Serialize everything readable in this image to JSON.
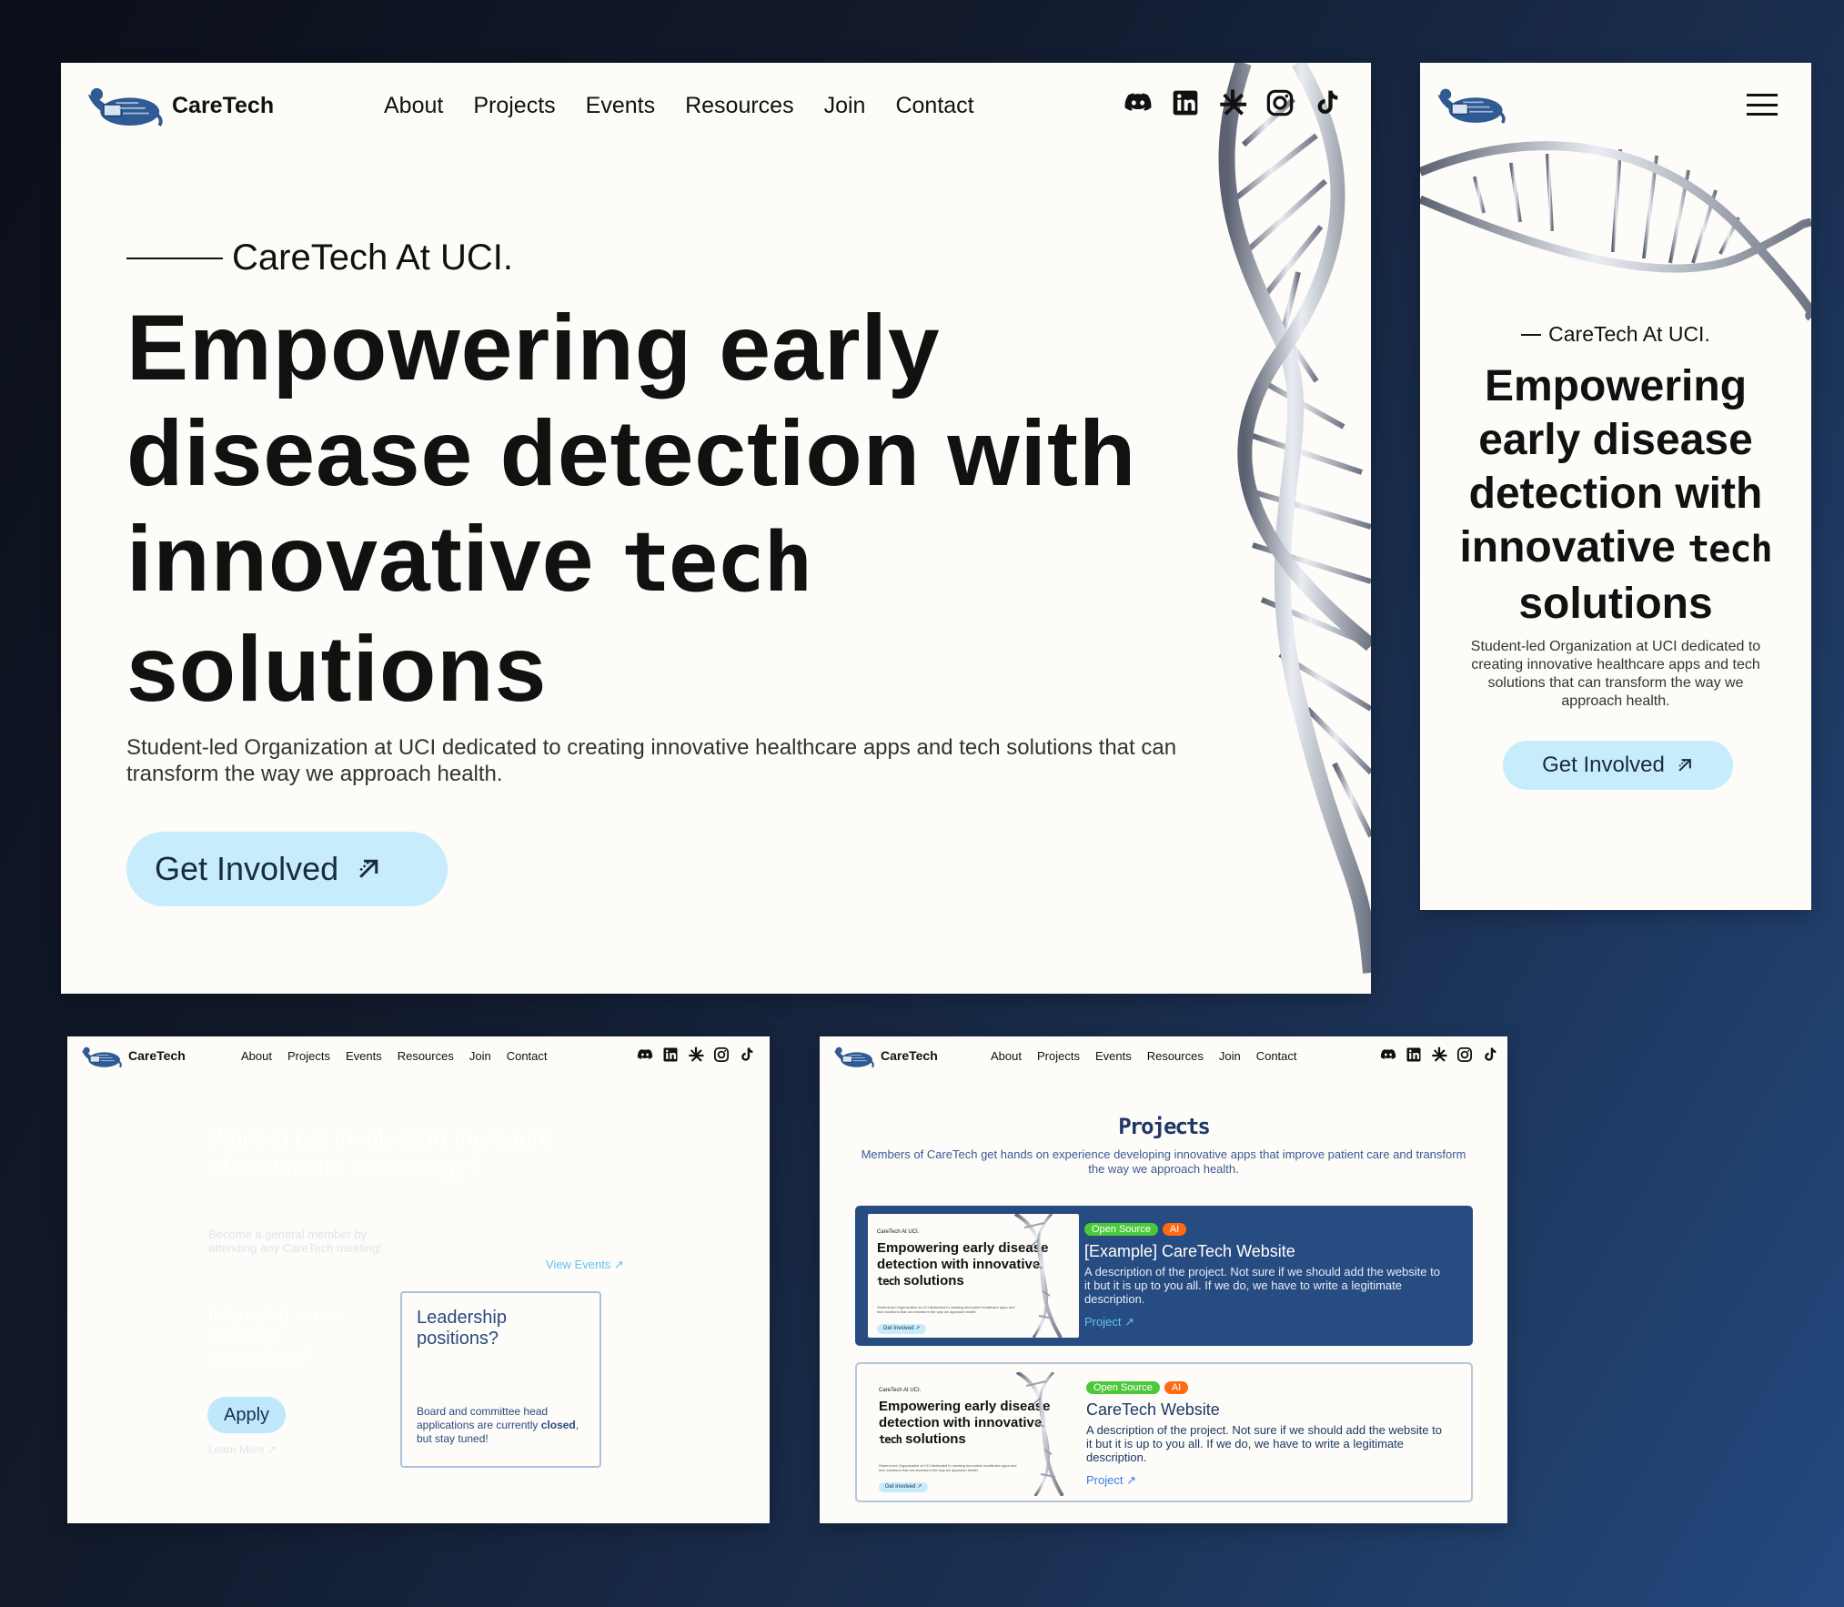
{
  "brand": "CareTech",
  "nav": [
    "About",
    "Projects",
    "Events",
    "Resources",
    "Join",
    "Contact"
  ],
  "social_icons": [
    "discord-icon",
    "linkedin-icon",
    "linktree-icon",
    "instagram-icon",
    "tiktok-icon"
  ],
  "hero": {
    "kicker": "CareTech At UCI.",
    "headline_main": "Empowering early disease detection with innovative",
    "headline_tech": "tech",
    "headline_end": "solutions",
    "mobile_line1": "Empowering",
    "mobile_line2": "early disease",
    "mobile_line3": "detection with",
    "mobile_line4a": "innovative",
    "subtitle": "Student-led Organization at UCI dedicated to creating innovative healthcare apps and tech solutions that can transform the way we approach health.",
    "cta": "Get Involved",
    "cta_icon": "arrow-up-right-icon"
  },
  "involve": {
    "card1_title": "Want to get involved in the future of healthcare technology?",
    "card1_sub": "Become a general member by attending any CareTech meeting!",
    "card1_link": "View Events ↗",
    "card2_title": "Interested in our amazing committees?",
    "card2_button": "Apply",
    "card2_link": "Learn More ↗",
    "card3_title": "Leadership positions?",
    "card3_text_a": "Board and committee head applications are currently ",
    "card3_text_b": "closed",
    "card3_text_c": ", but stay tuned!"
  },
  "projects": {
    "title": "Projects",
    "description": "Members of CareTech get hands on experience developing innovative apps that improve patient care and transform the way we approach health.",
    "thumb_kicker": "CareTech At UCI.",
    "thumb_head": "Empowering early disease detection with innovative",
    "thumb_tech": "tech",
    "thumb_end": "solutions",
    "thumb_sub": "Student-led Organization at UCI dedicated to creating innovative healthcare apps and tech solutions that can transform the way we approach health.",
    "thumb_cta": "Get Involved ↗",
    "items": [
      {
        "tags": [
          "Open Source",
          "AI"
        ],
        "name": "[Example] CareTech Website",
        "description": "A description of the project. Not sure if we should add the website to it but it is up to you all. If we do, we have to write a legitimate description.",
        "link": "Project ↗"
      },
      {
        "tags": [
          "Open Source",
          "AI"
        ],
        "name": "CareTech Website",
        "description": "A description of the project. Not sure if we should add the website to it but it is up to you all. If we do, we have to write a legitimate description.",
        "link": "Project ↗"
      }
    ]
  }
}
